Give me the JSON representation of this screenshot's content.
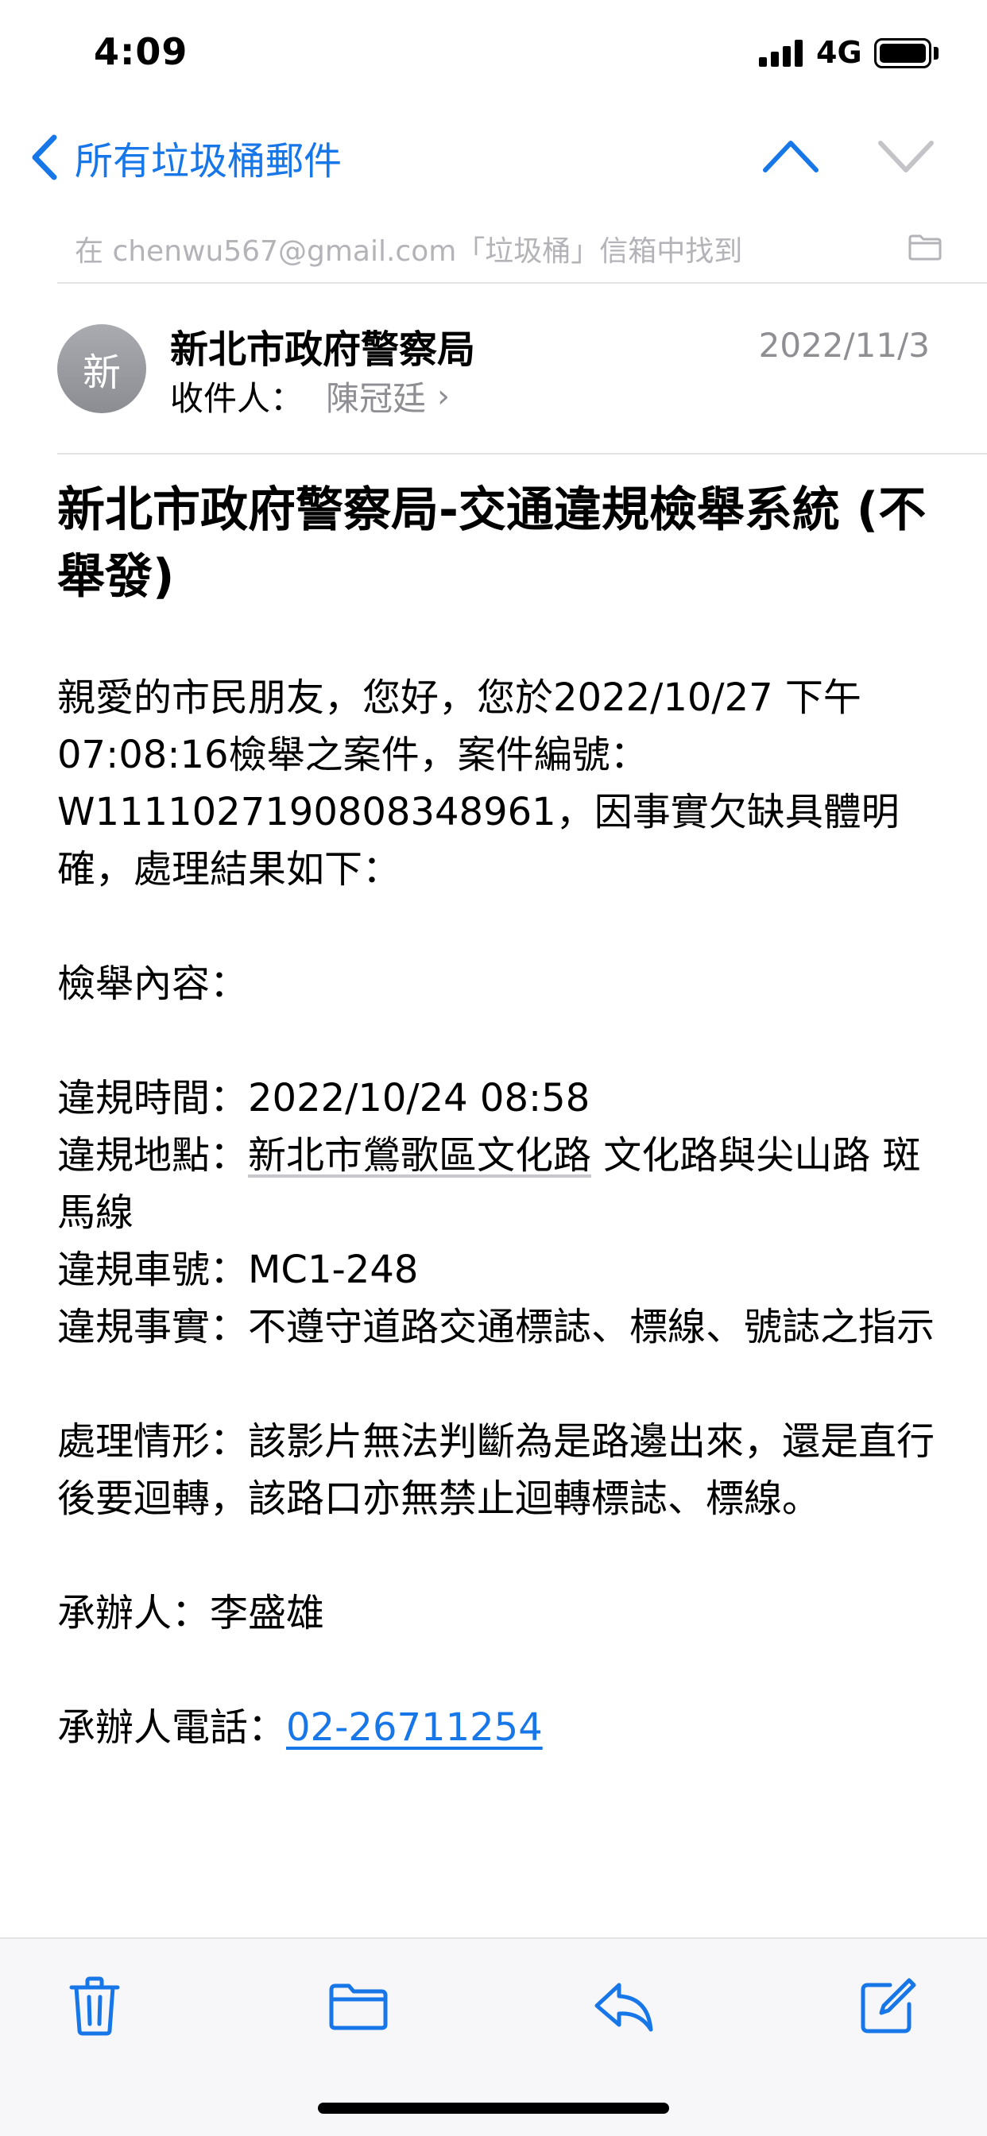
{
  "status_bar": {
    "time": "4:09",
    "network": "4G"
  },
  "nav": {
    "back_label": "所有垃圾桶郵件",
    "accent_color": "#1877e8"
  },
  "banner": {
    "found_text": "在 chenwu567@gmail.com「垃圾桶」信箱中找到"
  },
  "header": {
    "avatar_initial": "新",
    "sender": "新北市政府警察局",
    "recipient_label": "收件人：",
    "recipient_name": "陳冠廷",
    "date": "2022/11/3"
  },
  "subject": "新北市政府警察局-交通違規檢舉系統 (不舉發)",
  "body": {
    "greeting": "親愛的市民朋友，您好，您於2022/10/27 下午07:08:16檢舉之案件，案件編號：W1111027190808348961，因事實欠缺具體明確，處理結果如下：",
    "content_heading": "檢舉內容：",
    "violation_time_label": "違規時間：",
    "violation_time": "2022/10/24 08:58",
    "violation_place_label": "違規地點：",
    "violation_place_link": "新北市鶯歌區文化路",
    "violation_place_rest": " 文化路與尖山路 斑馬線",
    "plate_label": "違規車號：",
    "plate": "MC1-248",
    "fact_label": "違規事實：",
    "fact": "不遵守道路交通標誌、標線、號誌之指示",
    "handling_label": "處理情形：",
    "handling": "該影片無法判斷為是路邊出來，還是直行後要迴轉，該路口亦無禁止迴轉標誌、標線。",
    "officer_label": "承辦人：",
    "officer": "李盛雄",
    "phone_label": "承辦人電話：",
    "phone": "02-26711254"
  },
  "toolbar": {
    "icons": [
      "trash-icon",
      "folder-icon",
      "reply-icon",
      "compose-icon"
    ]
  }
}
